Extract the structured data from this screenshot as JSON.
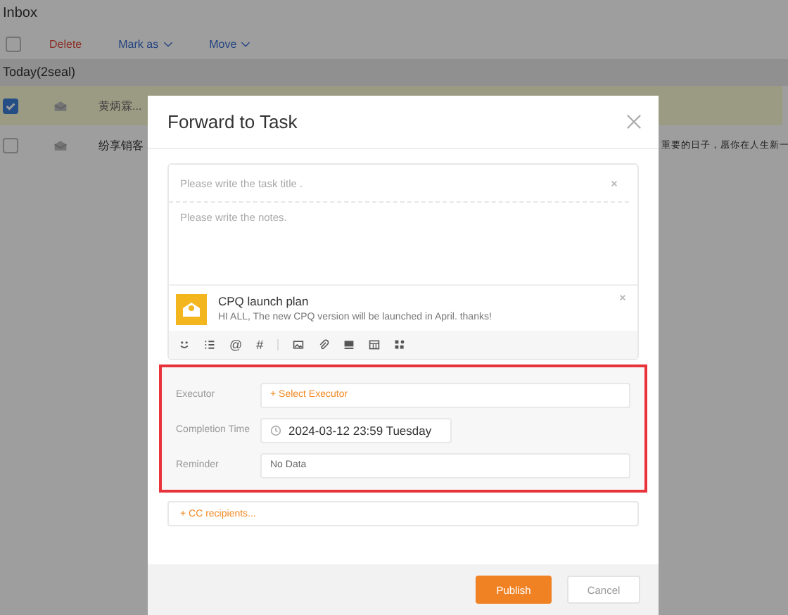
{
  "page": {
    "title": "Inbox"
  },
  "toolbar": {
    "select_all_checked": false,
    "actions": [
      {
        "label": "Delete",
        "kind": "danger"
      },
      {
        "label": "Mark as",
        "kind": "menu"
      },
      {
        "label": "Move",
        "kind": "menu"
      }
    ]
  },
  "group": {
    "label": "Today(2seal)"
  },
  "messages": [
    {
      "sender": "黄炳霖...",
      "checked": true
    },
    {
      "sender": "纷享销客",
      "preview": "重要的日子，愿你在人生新一",
      "checked": false
    }
  ],
  "dialog": {
    "title": "Forward to Task",
    "title_field": {
      "placeholder": "Please write the task title ."
    },
    "notes_field": {
      "placeholder": "Please write the notes."
    },
    "attachment": {
      "title": "CPQ launch plan",
      "text": "HI ALL, The new CPQ version will be launched in April. thanks!"
    },
    "editor_symbols": [
      "@",
      "#"
    ],
    "highlighted": true,
    "fields": [
      {
        "label": "Executor",
        "kind": "picker",
        "value": "+ Select Executor"
      },
      {
        "label": "Completion Time",
        "kind": "date",
        "value": "2024-03-12 23:59 Tuesday"
      },
      {
        "label": "Reminder",
        "kind": "select",
        "value": "No Data"
      }
    ],
    "cc": {
      "label": "+ CC recipients..."
    },
    "buttons": [
      {
        "label": "Publish",
        "kind": "primary"
      },
      {
        "label": "Cancel",
        "kind": "default"
      }
    ]
  }
}
